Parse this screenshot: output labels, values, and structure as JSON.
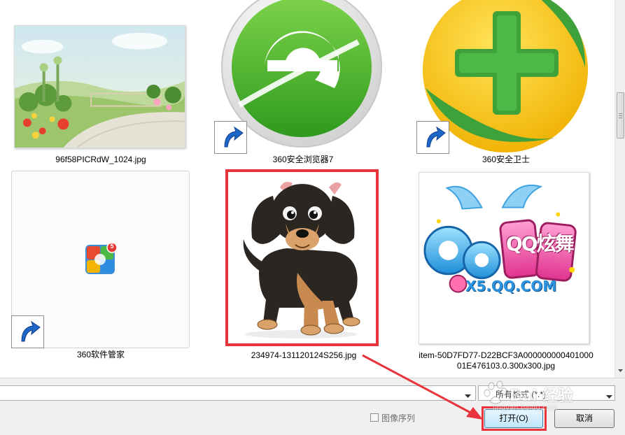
{
  "files": [
    {
      "name": "96f58PICRdW_1024.jpg",
      "kind": "image",
      "shortcut": false
    },
    {
      "name": "360安全浏览器7",
      "kind": "shortcut",
      "shortcut": true
    },
    {
      "name": "360安全卫士",
      "kind": "shortcut",
      "shortcut": true
    },
    {
      "name": "360软件管家",
      "kind": "shortcut",
      "shortcut": true,
      "badge": "5"
    },
    {
      "name": "234974-131120124S256.jpg",
      "kind": "image",
      "shortcut": false,
      "selected": true
    },
    {
      "name": "item-50D7FD77-D22BCF3A00000000040100001E476103.0.300x300.jpg",
      "caption_line1": "item-50D7FD77-D22BCF3A000000000401000",
      "caption_line2": "01E476103.0.300x300.jpg",
      "kind": "image",
      "shortcut": false
    }
  ],
  "logo_text": {
    "qq_dance": "QQ炫舞",
    "site": "X5.QQ.COM"
  },
  "bottom": {
    "filename_value": "",
    "filetype_value": "所有格式 (*.*)",
    "image_sequence_label": "图像序列",
    "image_sequence_checked": false,
    "open_label": "打开(O)",
    "cancel_label": "取消"
  },
  "watermark": {
    "text": "Bai 经验",
    "url": "jingyan.baidu.com"
  },
  "colors": {
    "highlight": "#e8343a",
    "browser_green": "#43b02a",
    "guard_yellow": "#f5c400"
  }
}
